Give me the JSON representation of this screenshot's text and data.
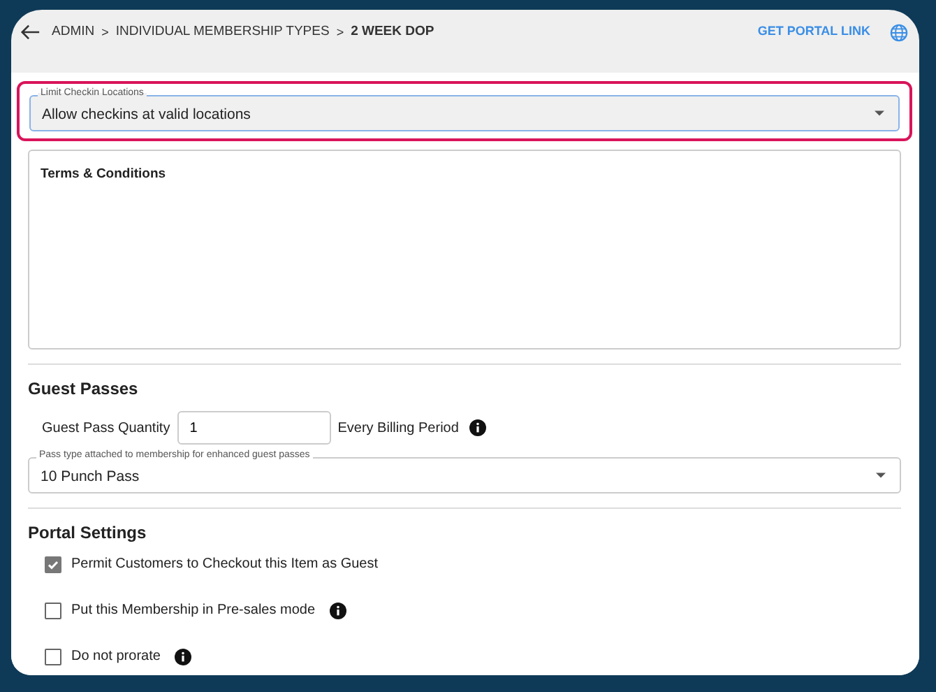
{
  "breadcrumb": {
    "items": [
      "ADMIN",
      "INDIVIDUAL MEMBERSHIP TYPES"
    ],
    "current": "2 WEEK DOP",
    "separator": ">"
  },
  "header_link": "GET PORTAL LINK",
  "checkin_select": {
    "label": "Limit Checkin Locations",
    "value": "Allow checkins at valid locations",
    "highlighted": true
  },
  "terms": {
    "label": "Terms & Conditions"
  },
  "guest_passes": {
    "title": "Guest Passes",
    "quantity_label": "Guest Pass Quantity",
    "quantity": "1",
    "period": "Every Billing Period",
    "pass_select": {
      "label": "Pass type attached to membership for enhanced guest passes",
      "value": "10 Punch Pass"
    }
  },
  "portal_settings": {
    "title": "Portal Settings",
    "options": [
      {
        "label": "Permit Customers to Checkout this Item as Guest",
        "checked": true,
        "info": false
      },
      {
        "label": "Put this Membership in Pre-sales mode",
        "checked": false,
        "info": true
      },
      {
        "label": "Do not prorate",
        "checked": false,
        "info": true
      }
    ]
  }
}
